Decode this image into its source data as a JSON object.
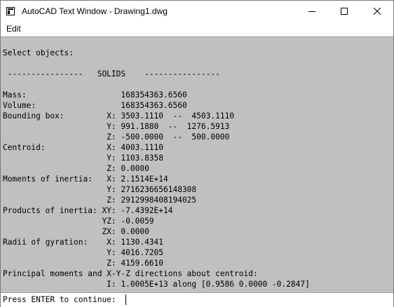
{
  "window": {
    "title": "AutoCAD Text Window - Drawing1.dwg",
    "icon": "autocad-app-icon"
  },
  "menu": {
    "items": [
      {
        "label": "Edit"
      }
    ]
  },
  "output": {
    "lines": [
      "Select objects:",
      "",
      " ----------------   SOLIDS    ----------------",
      "",
      "Mass:                    168354363.6560",
      "Volume:                  168354363.6560",
      "Bounding box:         X: 3503.1110  --  4503.1110",
      "                      Y: 991.1880  --  1276.5913",
      "                      Z: -500.0000  --  500.0000",
      "Centroid:             X: 4003.1110",
      "                      Y: 1103.8358",
      "                      Z: 0.0000",
      "Moments of inertia:   X: 2.1514E+14",
      "                      Y: 2716236656148308",
      "                      Z: 2912998408194025",
      "Products of inertia: XY: -7.4392E+14",
      "                     YZ: -0.0059",
      "                     ZX: 0.0000",
      "Radii of gyration:    X: 1130.4341",
      "                      Y: 4016.7205",
      "                      Z: 4159.6610",
      "Principal moments and X-Y-Z directions about centroid:",
      "                      I: 1.0005E+13 along [0.9586 0.0000 -0.2847]"
    ]
  },
  "command": {
    "prompt": "Press ENTER to continue:",
    "value": ""
  },
  "colors": {
    "text_area_bg": "#c0c0c0",
    "titlebar_bg": "#ffffff"
  }
}
